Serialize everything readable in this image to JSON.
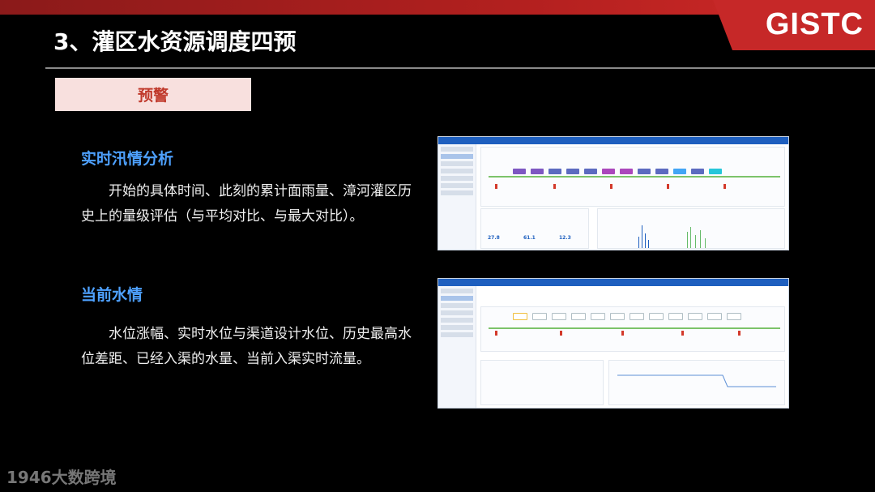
{
  "slide": {
    "title": "3、灌区水资源调度四预",
    "badge": "预警",
    "logo": "GISTC",
    "footer": "1946大数跨境"
  },
  "sections": [
    {
      "heading": "实时汛情分析",
      "body": "开始的具体时间、此刻的累计面雨量、漳河灌区历史上的量级评估（与平均对比、与最大对比）。"
    },
    {
      "heading": "当前水情",
      "body": "水位涨幅、实时水位与渠道设计水位、历史最高水位差距、已经入渠的水量、当前入渠实时流量。"
    }
  ],
  "screenshot_top": {
    "stats": [
      "27.8",
      "61.1",
      "12.3"
    ]
  },
  "colors": {
    "accent_blue": "#4ea1ff",
    "badge_text": "#c0392b",
    "badge_bg": "#f8e0de",
    "top_red": "#c0392b"
  }
}
